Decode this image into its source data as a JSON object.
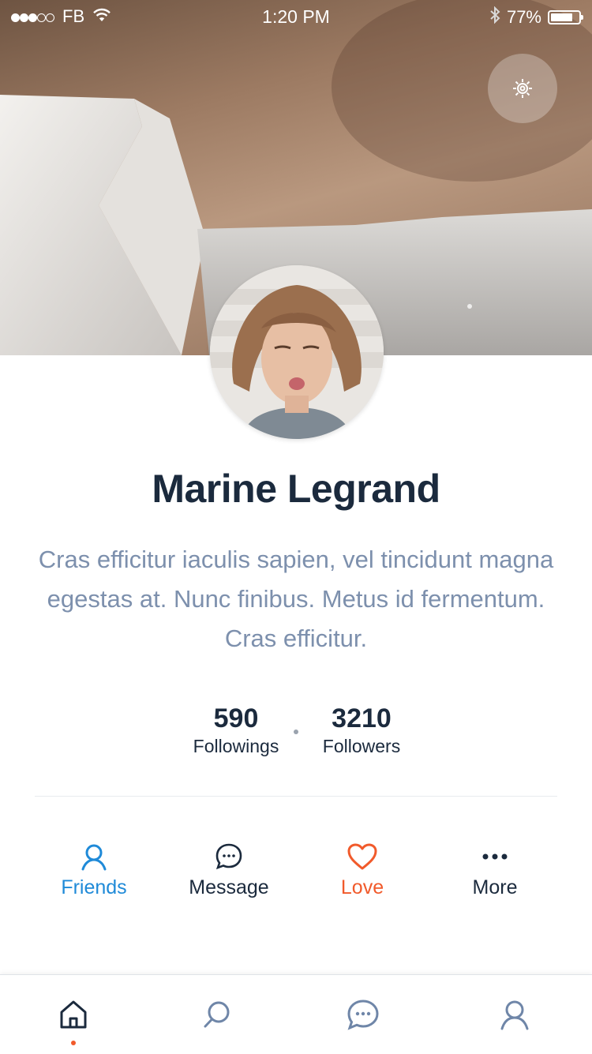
{
  "status_bar": {
    "carrier": "FB",
    "time": "1:20 PM",
    "battery": "77%",
    "battery_level": 0.77,
    "icons": [
      "signal-dots",
      "wifi-icon",
      "bluetooth-icon",
      "battery-icon"
    ]
  },
  "header": {
    "settings_icon": "gear-icon"
  },
  "profile": {
    "name": "Marine Legrand",
    "bio": "Cras efficitur iaculis sapien, vel tincidunt magna egestas at. Nunc finibus. Metus id fermentum. Cras efficitur."
  },
  "stats": {
    "followings": {
      "value": "590",
      "label": "Followings"
    },
    "followers": {
      "value": "3210",
      "label": "Followers"
    }
  },
  "actions": [
    {
      "label": "Friends",
      "icon": "user-icon",
      "color": "#1f8ad8"
    },
    {
      "label": "Message",
      "icon": "chat-bubble-icon",
      "color": "#1b2a3d"
    },
    {
      "label": "Love",
      "icon": "heart-icon",
      "color": "#f15a2b"
    },
    {
      "label": "More",
      "icon": "more-dots-icon",
      "color": "#1b2a3d"
    }
  ],
  "tab_bar": {
    "tabs": [
      {
        "icon": "home-icon",
        "active": true
      },
      {
        "icon": "search-icon",
        "active": false
      },
      {
        "icon": "chat-icon",
        "active": false
      },
      {
        "icon": "profile-icon",
        "active": false
      }
    ]
  },
  "colors": {
    "text_dark": "#1b2a3d",
    "bio_text": "#7d90ad",
    "accent_blue": "#1f8ad8",
    "accent_orange": "#f15a2b",
    "tab_icon": "#6f86a8"
  }
}
